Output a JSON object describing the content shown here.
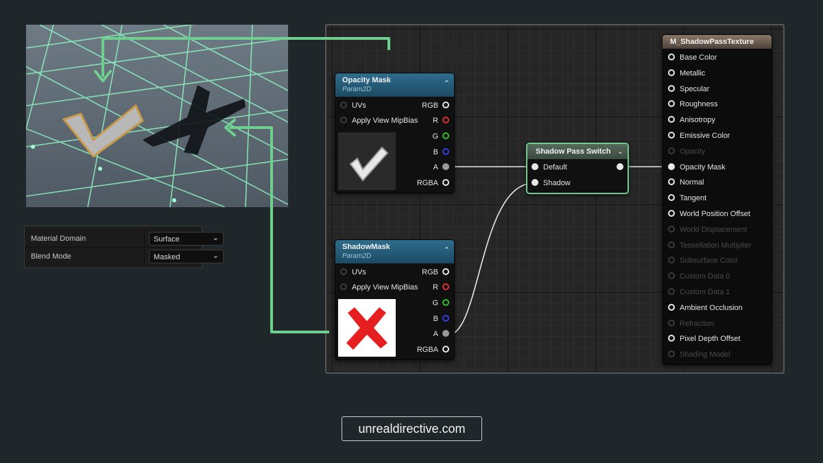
{
  "details": {
    "rows": [
      {
        "label": "Material Domain",
        "value": "Surface"
      },
      {
        "label": "Blend Mode",
        "value": "Masked"
      }
    ]
  },
  "nodes": {
    "opacity_mask": {
      "title": "Opacity Mask",
      "subtitle": "Param2D",
      "inputs": [
        "UVs",
        "Apply View MipBias"
      ],
      "outputs": [
        "RGB",
        "R",
        "G",
        "B",
        "A",
        "RGBA"
      ]
    },
    "shadow_mask": {
      "title": "ShadowMask",
      "subtitle": "Param2D",
      "inputs": [
        "UVs",
        "Apply View MipBias"
      ],
      "outputs": [
        "RGB",
        "R",
        "G",
        "B",
        "A",
        "RGBA"
      ]
    },
    "shadow_pass_switch": {
      "title": "Shadow Pass Switch",
      "inputs": [
        "Default",
        "Shadow"
      ]
    },
    "result": {
      "title": "M_ShadowPassTexture",
      "pins": [
        {
          "label": "Base Color",
          "enabled": true
        },
        {
          "label": "Metallic",
          "enabled": true
        },
        {
          "label": "Specular",
          "enabled": true
        },
        {
          "label": "Roughness",
          "enabled": true
        },
        {
          "label": "Anisotropy",
          "enabled": true
        },
        {
          "label": "Emissive Color",
          "enabled": true
        },
        {
          "label": "Opacity",
          "enabled": false
        },
        {
          "label": "Opacity Mask",
          "enabled": true,
          "connected": true
        },
        {
          "label": "Normal",
          "enabled": true
        },
        {
          "label": "Tangent",
          "enabled": true
        },
        {
          "label": "World Position Offset",
          "enabled": true
        },
        {
          "label": "World Displacement",
          "enabled": false
        },
        {
          "label": "Tessellation Multiplier",
          "enabled": false
        },
        {
          "label": "Subsurface Color",
          "enabled": false
        },
        {
          "label": "Custom Data 0",
          "enabled": false
        },
        {
          "label": "Custom Data 1",
          "enabled": false
        },
        {
          "label": "Ambient Occlusion",
          "enabled": true
        },
        {
          "label": "Refraction",
          "enabled": false
        },
        {
          "label": "Pixel Depth Offset",
          "enabled": true
        },
        {
          "label": "Shading Model",
          "enabled": false
        }
      ]
    }
  },
  "colors": {
    "accent_green": "#6fcf8f",
    "node_header_blue": "#2e6d8d",
    "pin_red": "#e03030",
    "pin_green": "#30c030",
    "pin_blue": "#3040e0"
  },
  "footer": {
    "link": "unrealdirective.com"
  }
}
